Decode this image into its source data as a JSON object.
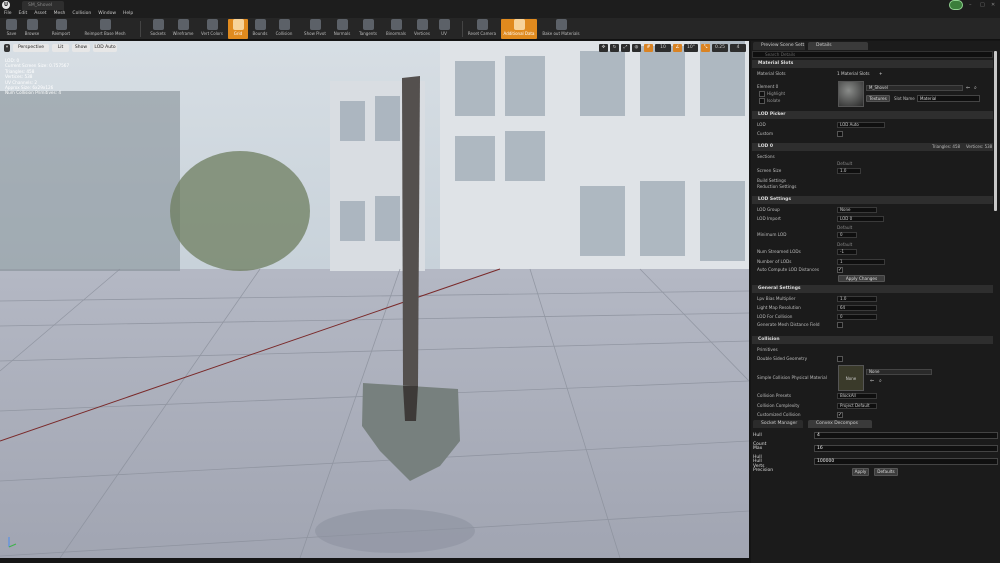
{
  "titlebar": {
    "logo": "U",
    "tab": "SM_Shovel"
  },
  "menu": [
    "File",
    "Edit",
    "Asset",
    "Mesh",
    "Collision",
    "Window",
    "Help"
  ],
  "toolbar": [
    {
      "label": "Save",
      "icon": "save-icon"
    },
    {
      "label": "Browse",
      "icon": "browse-icon"
    },
    {
      "label": "Reimport",
      "icon": "reimport-icon"
    },
    {
      "label": "Reimport Base Mesh",
      "icon": "reimport-base-mesh-icon"
    },
    {
      "label": "Sockets",
      "icon": "sockets-icon"
    },
    {
      "label": "Wireframe",
      "icon": "wireframe-icon"
    },
    {
      "label": "Vert Colors",
      "icon": "vert-colors-icon"
    },
    {
      "label": "Grid",
      "icon": "grid-icon",
      "active": true
    },
    {
      "label": "Bounds",
      "icon": "bounds-icon"
    },
    {
      "label": "Collision",
      "icon": "collision-icon"
    },
    {
      "label": "Show Pivot",
      "icon": "pivot-icon"
    },
    {
      "label": "Normals",
      "icon": "normals-icon"
    },
    {
      "label": "Tangents",
      "icon": "tangents-icon"
    },
    {
      "label": "Binormals",
      "icon": "binormals-icon"
    },
    {
      "label": "Vertices",
      "icon": "vertices-icon"
    },
    {
      "label": "UV",
      "icon": "uv-icon"
    },
    {
      "label": "Reset Camera",
      "icon": "reset-camera-icon"
    },
    {
      "label": "Additional Data",
      "icon": "additional-data-icon",
      "active": true
    },
    {
      "label": "Bake out Materials",
      "icon": "bake-materials-icon"
    }
  ],
  "viewport": {
    "buttons": {
      "perspective": "Perspective",
      "lit": "Lit",
      "show": "Show",
      "lod": "LOD Auto"
    },
    "stats": [
      "LOD: 0",
      "Current Screen Size: 0.757567",
      "Triangles: 458",
      "Vertices: 538",
      "UV Channels: 2",
      "Approx Size: 6x29x126",
      "Num Collision Primitives: 4"
    ],
    "right": {
      "grid": "10",
      "angle": "10°",
      "scale": "0.25",
      "speed": "4"
    }
  },
  "details": {
    "tab_preview": "Preview Scene Sett",
    "tab_details": "Details",
    "search_placeholder": "Search Details",
    "material_slots": {
      "header": "Material Slots",
      "label": "Material Slots",
      "count": "1 Material Slots",
      "element": "Element 0",
      "material": "M_Shovel",
      "highlight": "Highlight",
      "isolate": "Isolate",
      "textures": "Textures",
      "slot_name_label": "Slot Name",
      "slot_name": "Material"
    },
    "lod_picker": {
      "header": "LOD Picker",
      "lod_label": "LOD",
      "lod_value": "LOD Auto",
      "custom": "Custom"
    },
    "lod0": {
      "header": "LOD 0",
      "triangles": "Triangles: 458",
      "vertices": "Vertices: 538",
      "sections": "Sections",
      "screen_size": "Screen Size",
      "default": "Default",
      "screen_size_value": "1.0",
      "build_settings": "Build Settings",
      "reduction_settings": "Reduction Settings"
    },
    "lod_settings": {
      "header": "LOD Settings",
      "lod_group": "LOD Group",
      "lod_group_value": "None",
      "lod_import": "LOD Import",
      "lod_import_value": "LOD 0",
      "minimum_lods": "Minimum LOD",
      "default": "Default",
      "minimum_value": "0",
      "num_streamed": "Num Streamed LODs",
      "num_streamed_value": "-1",
      "number_of_lods": "Number of LODs",
      "number_of_lods_value": "1",
      "auto_compute": "Auto Compute LOD Distances",
      "apply": "Apply Changes"
    },
    "general": {
      "header": "General Settings",
      "lpv": "Lpv Bias Multiplier",
      "lpv_value": "1.0",
      "lightmap_res": "Light Map Resolution",
      "lightmap_res_value": "64",
      "lod_collision": "LOD For Collision",
      "lod_collision_value": "0",
      "distance_field": "Generate Mesh Distance Field"
    },
    "collision": {
      "header": "Collision",
      "primitives": "Primitives",
      "double_sided": "Double Sided Geometry",
      "physical_material": "Simple Collision Physical Material",
      "none": "None",
      "physmat_value": "None",
      "presets": "Collision Presets",
      "presets_value": "BlockAll",
      "complexity": "Collision Complexity",
      "complexity_value": "Project Default",
      "customized": "Customized Collision"
    }
  },
  "bottom": {
    "tab_socket": "Socket Manager",
    "tab_convex": "Convex Decompos",
    "hull_count": "Hull Count",
    "hull_count_value": "4",
    "max_verts": "Max Hull Verts",
    "max_verts_value": "16",
    "precision": "Hull Precision",
    "precision_value": "100000",
    "apply": "Apply",
    "defaults": "Defaults"
  },
  "colors": {
    "accent": "#e08a1e",
    "panel": "#1b1b1b"
  }
}
